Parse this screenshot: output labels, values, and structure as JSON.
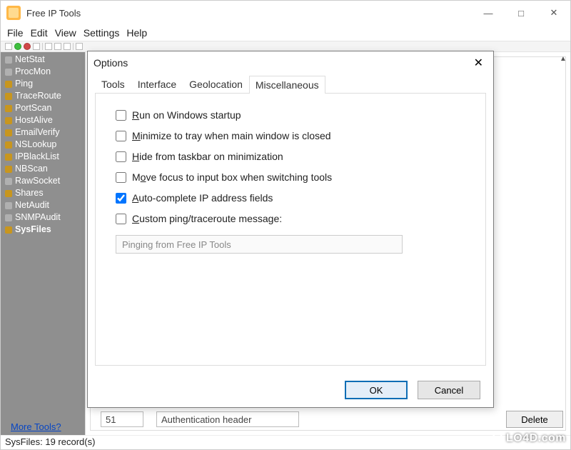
{
  "window": {
    "title": "Free IP Tools"
  },
  "menubar": [
    "File",
    "Edit",
    "View",
    "Settings",
    "Help"
  ],
  "sidebar": {
    "items": [
      {
        "label": "NetStat",
        "iconClass": "gray"
      },
      {
        "label": "ProcMon",
        "iconClass": "gray"
      },
      {
        "label": "Ping",
        "iconClass": ""
      },
      {
        "label": "TraceRoute",
        "iconClass": ""
      },
      {
        "label": "PortScan",
        "iconClass": ""
      },
      {
        "label": "HostAlive",
        "iconClass": ""
      },
      {
        "label": "EmailVerify",
        "iconClass": ""
      },
      {
        "label": "NSLookup",
        "iconClass": ""
      },
      {
        "label": "IPBlackList",
        "iconClass": ""
      },
      {
        "label": "NBScan",
        "iconClass": ""
      },
      {
        "label": "RawSocket",
        "iconClass": "gray"
      },
      {
        "label": "Shares",
        "iconClass": ""
      },
      {
        "label": "NetAudit",
        "iconClass": "gray"
      },
      {
        "label": "SNMPAudit",
        "iconClass": "gray"
      },
      {
        "label": "SysFiles",
        "iconClass": "",
        "selected": true
      }
    ]
  },
  "bottom": {
    "num_value": "51",
    "txt_value": "Authentication header",
    "delete_label": "Delete"
  },
  "more_tools_label": "More Tools?",
  "status": "SysFiles: 19 record(s)",
  "watermark": "LO4D.com",
  "dialog": {
    "title": "Options",
    "tabs": [
      "Tools",
      "Interface",
      "Geolocation",
      "Miscellaneous"
    ],
    "active_tab": 3,
    "options": [
      {
        "label_pre": "",
        "mnemonic": "R",
        "label_post": "un on Windows startup",
        "checked": false
      },
      {
        "label_pre": "",
        "mnemonic": "M",
        "label_post": "inimize to tray when main window is closed",
        "checked": false
      },
      {
        "label_pre": "",
        "mnemonic": "H",
        "label_post": "ide from taskbar on minimization",
        "checked": false
      },
      {
        "label_pre": "M",
        "mnemonic": "o",
        "label_post": "ve focus to input box when switching tools",
        "checked": false
      },
      {
        "label_pre": "",
        "mnemonic": "A",
        "label_post": "uto-complete IP address fields",
        "checked": true
      },
      {
        "label_pre": "",
        "mnemonic": "C",
        "label_post": "ustom ping/traceroute message:",
        "checked": false
      }
    ],
    "custom_message": "Pinging from Free IP Tools",
    "ok_label": "OK",
    "cancel_label": "Cancel"
  }
}
